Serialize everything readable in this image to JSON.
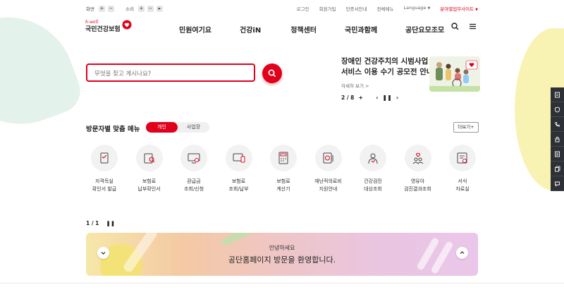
{
  "utility": {
    "font_label": "화면",
    "sound_label": "소리",
    "links": [
      {
        "label": "로그인",
        "red": false,
        "caret": false
      },
      {
        "label": "회원가입",
        "red": false,
        "caret": false
      },
      {
        "label": "인증서안내",
        "red": false,
        "caret": false
      },
      {
        "label": "전체메뉴",
        "red": false,
        "caret": false
      },
      {
        "label": "Language",
        "red": false,
        "caret": true
      },
      {
        "label": "분야별업무사이트",
        "red": true,
        "caret": true
      }
    ]
  },
  "logo": {
    "sub": "h-well",
    "main": "국민건강보험"
  },
  "gnb": [
    "민원여기요",
    "건강iN",
    "정책센터",
    "국민과함께",
    "공단요모조모"
  ],
  "search": {
    "placeholder": "무엇을 찾고 계시나요?"
  },
  "banner": {
    "title_line1": "장애인 건강주치의 시범사업",
    "title_line2": "서비스 이용 수기 공모전 안내",
    "more": "자세히 보기 >",
    "pager": "2 / 8"
  },
  "visitor": {
    "title": "방문자별 맞춤 메뉴",
    "tabs": [
      {
        "label": "개인",
        "active": true
      },
      {
        "label": "사업장",
        "active": false
      }
    ],
    "more": "더보기+"
  },
  "menu": [
    {
      "label": "자격득실\n확인서 발급",
      "icon": "certificate-icon"
    },
    {
      "label": "보험료\n납부확인서",
      "icon": "document-search-icon"
    },
    {
      "label": "환급금\n조회/신청",
      "icon": "refund-monitor-icon"
    },
    {
      "label": "보험료\n조회/납부",
      "icon": "payment-monitor-icon"
    },
    {
      "label": "보험료\n계산기",
      "icon": "calculator-icon"
    },
    {
      "label": "재난적의료비\n지원안내",
      "icon": "medical-support-icon"
    },
    {
      "label": "건강검진\n대상조회",
      "icon": "health-checkup-icon"
    },
    {
      "label": "영유아\n검진결과조회",
      "icon": "infant-heart-icon"
    },
    {
      "label": "서식\n자료실",
      "icon": "form-document-icon"
    }
  ],
  "pager": {
    "text": "1 / 1"
  },
  "welcome": {
    "small": "안녕하세요",
    "big": "공단홈페이지 방문을 환영합니다."
  },
  "colors": {
    "brand_red": "#e0001b",
    "quick_bar": "#2d3136"
  }
}
